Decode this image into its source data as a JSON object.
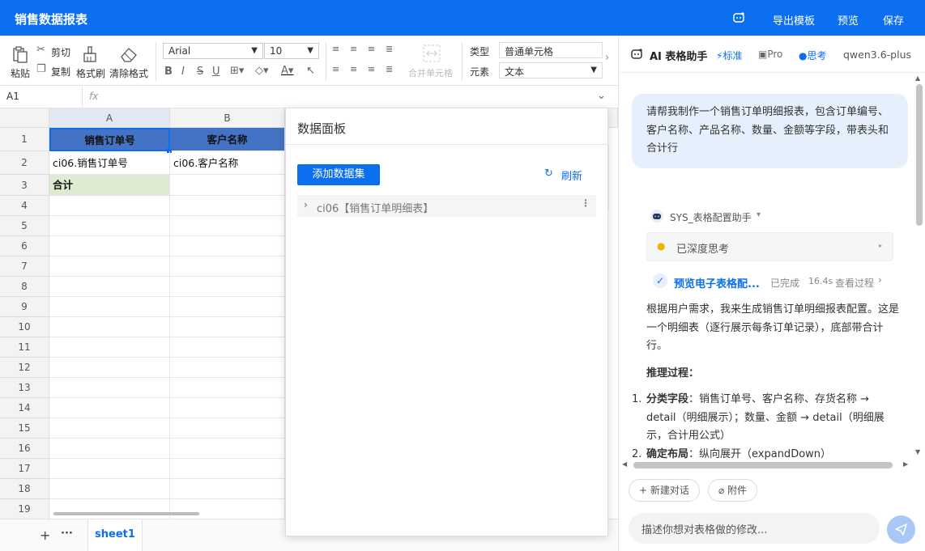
{
  "app": {
    "title": "销售数据报表",
    "export_label": "导出模板",
    "preview_label": "预览",
    "save_label": "保存"
  },
  "toolbar": {
    "paste": "粘贴",
    "cut": "剪切",
    "copy": "复制",
    "format_painter": "格式刷",
    "clear_format": "清除格式",
    "font_family": "Arial",
    "font_size": "10",
    "merge": "合并单元格",
    "type_label": "类型",
    "type_value": "普通单元格",
    "element_label": "元素",
    "element_value": "文本"
  },
  "formula": {
    "cell_ref": "A1",
    "fx": "fx"
  },
  "grid": {
    "columns": [
      "A",
      "B"
    ],
    "rows": [
      "1",
      "2",
      "3",
      "4",
      "5",
      "6",
      "7",
      "8",
      "9",
      "10",
      "11",
      "12",
      "13",
      "14",
      "15",
      "16",
      "17",
      "18",
      "19"
    ],
    "header_a": "销售订单号",
    "header_b": "客户名称",
    "r2a": "ci06.销售订单号",
    "r2b": "ci06.客户名称",
    "r3a": "合计"
  },
  "sheets": {
    "active": "sheet1"
  },
  "data_panel": {
    "title": "数据面板",
    "add_dataset": "添加数据集",
    "refresh": "刷新",
    "dataset": "ci06【销售订单明细表】"
  },
  "assistant": {
    "title": "AI 表格助手",
    "mode_standard": "标准",
    "mode_pro": "Pro",
    "think": "思考",
    "model": "qwen3.6-plus",
    "user_message": "请帮我制作一个销售订单明细报表，包含订单编号、客户名称、产品名称、数量、金额等字段，带表头和合计行",
    "bot_name": "SYS_表格配置助手",
    "deep_think": "已深度思考",
    "task_label": "预览电子表格配...",
    "task_status": "已完成",
    "task_time": "16.4s",
    "task_view": "查看过程",
    "reply": "根据用户需求，我来生成销售订单明细报表配置。这是一个明细表（逐行展示每条订单记录），底部带合计行。",
    "reasoning_title": "推理过程：",
    "step1_label": "分类字段",
    "step1_text": "：销售订单号、客户名称、存货名称 → detail（明细展示）；数量、金额 → detail（明细展示，合计用公式）",
    "step2_label": "确定布局",
    "step2_text": "：纵向展开（expandDown）",
    "new_chat": "新建对话",
    "attach": "附件",
    "input_placeholder": "描述你想对表格做的修改..."
  },
  "colors": {
    "brand": "#0b6ff0",
    "header_fill": "#4472c4",
    "total_fill": "#dcebd2"
  }
}
